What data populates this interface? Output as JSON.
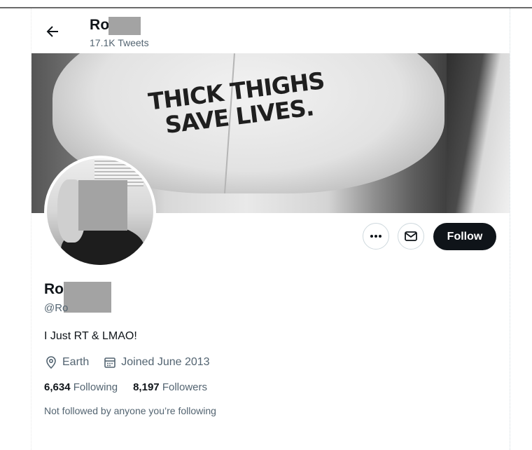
{
  "header": {
    "name_visible": "Ro",
    "tweets_count": "17.1K Tweets"
  },
  "banner": {
    "cap_line1": "THICK THIGHS",
    "cap_line2": "SAVE LIVES."
  },
  "actions": {
    "more_icon": "more-horizontal-icon",
    "message_icon": "envelope-icon",
    "follow_label": "Follow"
  },
  "profile": {
    "name_visible": "Ro",
    "handle_visible": "@Ro",
    "bio": "I Just RT & LMAO!",
    "location": "Earth",
    "joined": "Joined June 2013",
    "following_count": "6,634",
    "following_label": "Following",
    "followers_count": "8,197",
    "followers_label": "Followers",
    "followed_note": "Not followed by anyone you’re following"
  },
  "colors": {
    "text": "#0f1419",
    "secondary": "#536471",
    "follow_bg": "#0f1419",
    "redaction": "#a3a3a3"
  }
}
